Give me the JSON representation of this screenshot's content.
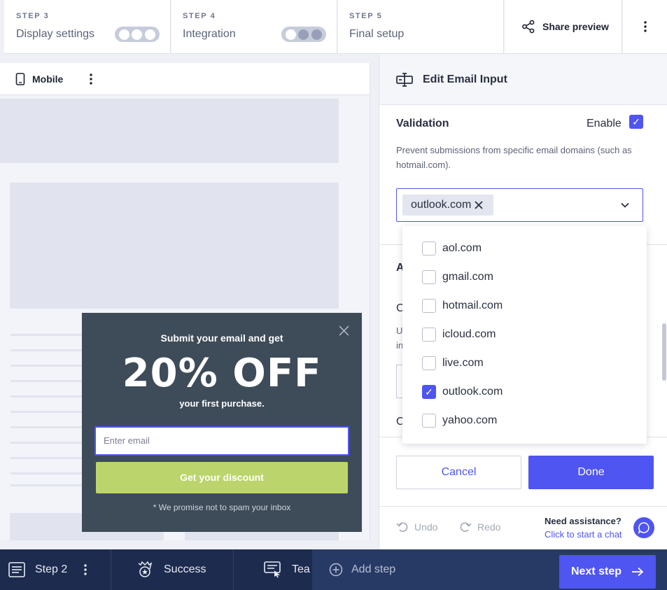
{
  "steps": [
    {
      "label": "STEP 3",
      "name": "Display settings"
    },
    {
      "label": "STEP 4",
      "name": "Integration"
    },
    {
      "label": "STEP 5",
      "name": "Final setup"
    }
  ],
  "share_label": "Share preview",
  "canvas": {
    "device_label": "Mobile"
  },
  "popup": {
    "headline": "Submit your email and get",
    "offer": "20% OFF",
    "subline": "your first purchase.",
    "email_placeholder": "Enter email",
    "cta": "Get your discount",
    "note": "* We promise not to spam your inbox"
  },
  "panel": {
    "title": "Edit Email Input",
    "validation_title": "Validation",
    "enable_label": "Enable",
    "description": "Prevent submissions from specific email domains (such as hotmail.com).",
    "selected_chip": "outlook.com",
    "peek_a": "A",
    "peek_c1": "C",
    "peek_u": "U",
    "peek_in": "in",
    "peek_c2": "C",
    "cancel": "Cancel",
    "done": "Done",
    "undo": "Undo",
    "redo": "Redo",
    "assist_title": "Need assistance?",
    "assist_link": "Click to start a chat"
  },
  "dropdown": {
    "options": [
      {
        "label": "aol.com",
        "checked": false
      },
      {
        "label": "gmail.com",
        "checked": false
      },
      {
        "label": "hotmail.com",
        "checked": false
      },
      {
        "label": "icloud.com",
        "checked": false
      },
      {
        "label": "live.com",
        "checked": false
      },
      {
        "label": "outlook.com",
        "checked": true
      },
      {
        "label": "yahoo.com",
        "checked": false
      }
    ]
  },
  "bottom": {
    "step2": "Step 2",
    "success": "Success",
    "teaser": "Tea",
    "add_step": "Add step",
    "next": "Next step"
  },
  "colors": {
    "accent": "#4f55f0",
    "navy": "#1c2b4e",
    "popup_bg": "#3e4b59",
    "cta": "#bcd46c"
  }
}
